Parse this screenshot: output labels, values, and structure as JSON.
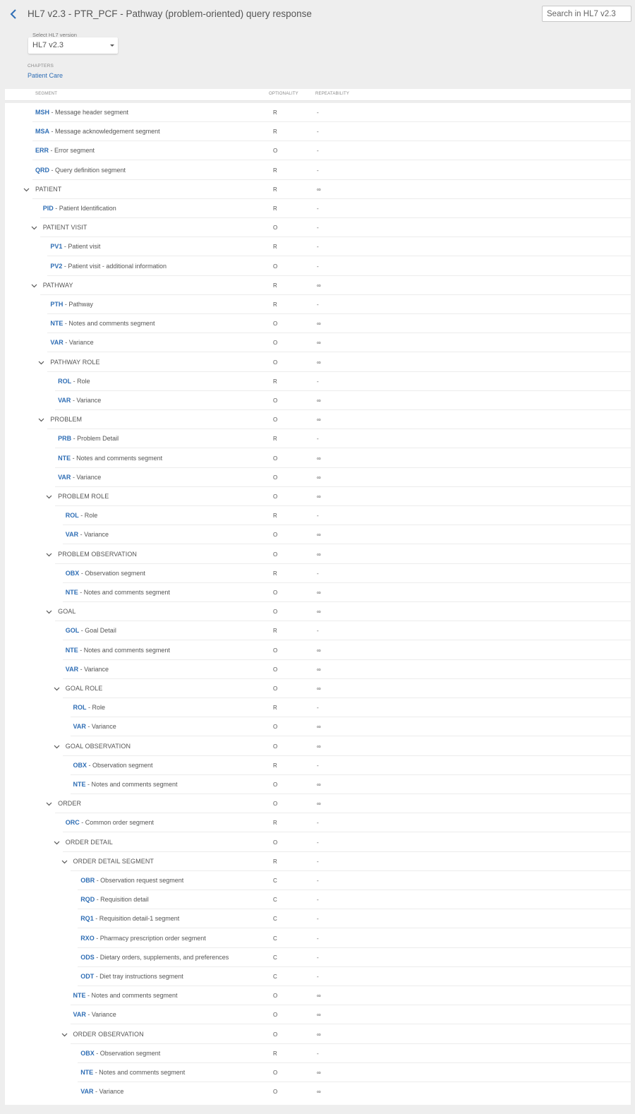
{
  "header": {
    "title": "HL7 v2.3 - PTR_PCF - Pathway (problem-oriented) query response",
    "search_placeholder": "Search in HL7 v2.3",
    "version_label": "Select HL7 version",
    "version_value": "HL7 v2.3",
    "chapters_label": "CHAPTERS",
    "chapter_link": "Patient Care"
  },
  "columns": {
    "segment": "SEGMENT",
    "optionality": "OPTIONALITY",
    "repeatability": "REPEATABILITY"
  },
  "rows": [
    {
      "type": "segment",
      "level": 0,
      "code": "MSH",
      "desc": " - Message header segment",
      "opt": "R",
      "rep": "-"
    },
    {
      "type": "segment",
      "level": 0,
      "code": "MSA",
      "desc": " - Message acknowledgement segment",
      "opt": "R",
      "rep": "-"
    },
    {
      "type": "segment",
      "level": 0,
      "code": "ERR",
      "desc": " - Error segment",
      "opt": "O",
      "rep": "-"
    },
    {
      "type": "segment",
      "level": 0,
      "code": "QRD",
      "desc": " - Query definition segment",
      "opt": "R",
      "rep": "-"
    },
    {
      "type": "group",
      "level": 0,
      "name": "PATIENT",
      "opt": "R",
      "rep": "∞"
    },
    {
      "type": "segment",
      "level": 1,
      "code": "PID",
      "desc": " - Patient Identification",
      "opt": "R",
      "rep": "-"
    },
    {
      "type": "group",
      "level": 1,
      "name": "PATIENT VISIT",
      "opt": "O",
      "rep": "-"
    },
    {
      "type": "segment",
      "level": 2,
      "code": "PV1",
      "desc": " - Patient visit",
      "opt": "R",
      "rep": "-"
    },
    {
      "type": "segment",
      "level": 2,
      "code": "PV2",
      "desc": " - Patient visit - additional information",
      "opt": "O",
      "rep": "-"
    },
    {
      "type": "group",
      "level": 1,
      "name": "PATHWAY",
      "opt": "R",
      "rep": "∞"
    },
    {
      "type": "segment",
      "level": 2,
      "code": "PTH",
      "desc": " - Pathway",
      "opt": "R",
      "rep": "-"
    },
    {
      "type": "segment",
      "level": 2,
      "code": "NTE",
      "desc": " - Notes and comments segment",
      "opt": "O",
      "rep": "∞"
    },
    {
      "type": "segment",
      "level": 2,
      "code": "VAR",
      "desc": " - Variance",
      "opt": "O",
      "rep": "∞"
    },
    {
      "type": "group",
      "level": 2,
      "name": "PATHWAY ROLE",
      "opt": "O",
      "rep": "∞"
    },
    {
      "type": "segment",
      "level": 3,
      "code": "ROL",
      "desc": " - Role",
      "opt": "R",
      "rep": "-"
    },
    {
      "type": "segment",
      "level": 3,
      "code": "VAR",
      "desc": " - Variance",
      "opt": "O",
      "rep": "∞"
    },
    {
      "type": "group",
      "level": 2,
      "name": "PROBLEM",
      "opt": "O",
      "rep": "∞"
    },
    {
      "type": "segment",
      "level": 3,
      "code": "PRB",
      "desc": " - Problem Detail",
      "opt": "R",
      "rep": "-"
    },
    {
      "type": "segment",
      "level": 3,
      "code": "NTE",
      "desc": " - Notes and comments segment",
      "opt": "O",
      "rep": "∞"
    },
    {
      "type": "segment",
      "level": 3,
      "code": "VAR",
      "desc": " - Variance",
      "opt": "O",
      "rep": "∞"
    },
    {
      "type": "group",
      "level": 3,
      "name": "PROBLEM ROLE",
      "opt": "O",
      "rep": "∞"
    },
    {
      "type": "segment",
      "level": 4,
      "code": "ROL",
      "desc": " - Role",
      "opt": "R",
      "rep": "-"
    },
    {
      "type": "segment",
      "level": 4,
      "code": "VAR",
      "desc": " - Variance",
      "opt": "O",
      "rep": "∞"
    },
    {
      "type": "group",
      "level": 3,
      "name": "PROBLEM OBSERVATION",
      "opt": "O",
      "rep": "∞"
    },
    {
      "type": "segment",
      "level": 4,
      "code": "OBX",
      "desc": " - Observation segment",
      "opt": "R",
      "rep": "-"
    },
    {
      "type": "segment",
      "level": 4,
      "code": "NTE",
      "desc": " - Notes and comments segment",
      "opt": "O",
      "rep": "∞"
    },
    {
      "type": "group",
      "level": 3,
      "name": "GOAL",
      "opt": "O",
      "rep": "∞"
    },
    {
      "type": "segment",
      "level": 4,
      "code": "GOL",
      "desc": " - Goal Detail",
      "opt": "R",
      "rep": "-"
    },
    {
      "type": "segment",
      "level": 4,
      "code": "NTE",
      "desc": " - Notes and comments segment",
      "opt": "O",
      "rep": "∞"
    },
    {
      "type": "segment",
      "level": 4,
      "code": "VAR",
      "desc": " - Variance",
      "opt": "O",
      "rep": "∞"
    },
    {
      "type": "group",
      "level": 4,
      "name": "GOAL ROLE",
      "opt": "O",
      "rep": "∞"
    },
    {
      "type": "segment",
      "level": 5,
      "code": "ROL",
      "desc": " - Role",
      "opt": "R",
      "rep": "-"
    },
    {
      "type": "segment",
      "level": 5,
      "code": "VAR",
      "desc": " - Variance",
      "opt": "O",
      "rep": "∞"
    },
    {
      "type": "group",
      "level": 4,
      "name": "GOAL OBSERVATION",
      "opt": "O",
      "rep": "∞"
    },
    {
      "type": "segment",
      "level": 5,
      "code": "OBX",
      "desc": " - Observation segment",
      "opt": "R",
      "rep": "-"
    },
    {
      "type": "segment",
      "level": 5,
      "code": "NTE",
      "desc": " - Notes and comments segment",
      "opt": "O",
      "rep": "∞"
    },
    {
      "type": "group",
      "level": 3,
      "name": "ORDER",
      "opt": "O",
      "rep": "∞"
    },
    {
      "type": "segment",
      "level": 4,
      "code": "ORC",
      "desc": " - Common order segment",
      "opt": "R",
      "rep": "-"
    },
    {
      "type": "group",
      "level": 4,
      "name": "ORDER DETAIL",
      "opt": "O",
      "rep": "-"
    },
    {
      "type": "group",
      "level": 5,
      "name": "ORDER DETAIL SEGMENT",
      "opt": "R",
      "rep": "-"
    },
    {
      "type": "segment",
      "level": 6,
      "code": "OBR",
      "desc": " - Observation request segment",
      "opt": "C",
      "rep": "-"
    },
    {
      "type": "segment",
      "level": 6,
      "code": "RQD",
      "desc": " - Requisition detail",
      "opt": "C",
      "rep": "-"
    },
    {
      "type": "segment",
      "level": 6,
      "code": "RQ1",
      "desc": " - Requisition detail-1 segment",
      "opt": "C",
      "rep": "-"
    },
    {
      "type": "segment",
      "level": 6,
      "code": "RXO",
      "desc": " - Pharmacy prescription order segment",
      "opt": "C",
      "rep": "-"
    },
    {
      "type": "segment",
      "level": 6,
      "code": "ODS",
      "desc": " - Dietary orders, supplements, and preferences",
      "opt": "C",
      "rep": "-"
    },
    {
      "type": "segment",
      "level": 6,
      "code": "ODT",
      "desc": " - Diet tray instructions segment",
      "opt": "C",
      "rep": "-"
    },
    {
      "type": "segment",
      "level": 5,
      "code": "NTE",
      "desc": " - Notes and comments segment",
      "opt": "O",
      "rep": "∞"
    },
    {
      "type": "segment",
      "level": 5,
      "code": "VAR",
      "desc": " - Variance",
      "opt": "O",
      "rep": "∞"
    },
    {
      "type": "group",
      "level": 5,
      "name": "ORDER OBSERVATION",
      "opt": "O",
      "rep": "∞"
    },
    {
      "type": "segment",
      "level": 6,
      "code": "OBX",
      "desc": " - Observation segment",
      "opt": "R",
      "rep": "-"
    },
    {
      "type": "segment",
      "level": 6,
      "code": "NTE",
      "desc": " - Notes and comments segment",
      "opt": "O",
      "rep": "∞"
    },
    {
      "type": "segment",
      "level": 6,
      "code": "VAR",
      "desc": " - Variance",
      "opt": "O",
      "rep": "∞"
    }
  ]
}
